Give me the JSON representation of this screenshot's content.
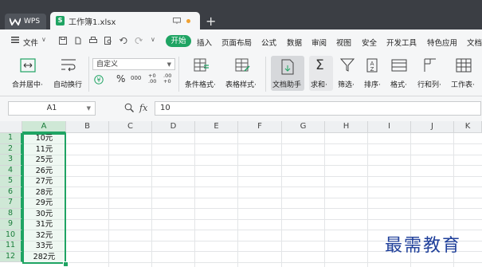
{
  "titlebar": {
    "wps_label": "WPS",
    "doc_tab": "工作簿1.xlsx",
    "add_tab": "+"
  },
  "menu": {
    "file": "文件",
    "start": "开始",
    "tabs": [
      "插入",
      "页面布局",
      "公式",
      "数据",
      "审阅",
      "视图",
      "安全",
      "开发工具",
      "特色应用",
      "文档"
    ]
  },
  "ribbon": {
    "merge": "合并居中·",
    "wrap": "自动换行",
    "number_format": "自定义",
    "percent": "%",
    "thousands": "000",
    "inc_decimal": "+0\n.00",
    "dec_decimal": ".00\n+0",
    "cond_format": "条件格式·",
    "table_style": "表格样式·",
    "doc_assist": "文档助手",
    "sum": "求和·",
    "filter": "筛选·",
    "sort": "排序·",
    "format": "格式·",
    "rowcol": "行和列·",
    "sheet": "工作表·"
  },
  "formula_bar": {
    "name_box": "A1",
    "fx": "fx",
    "value": "10"
  },
  "grid": {
    "columns": [
      "A",
      "B",
      "C",
      "D",
      "E",
      "F",
      "G",
      "H",
      "I",
      "J",
      "K"
    ],
    "rows": [
      "1",
      "2",
      "3",
      "4",
      "5",
      "6",
      "7",
      "8",
      "9",
      "10",
      "11",
      "12"
    ],
    "column_a": [
      "10元",
      "11元",
      "25元",
      "26元",
      "27元",
      "28元",
      "29元",
      "30元",
      "31元",
      "32元",
      "33元",
      "282元"
    ]
  },
  "watermark": "最需教育",
  "colors": {
    "accent": "#1fa463",
    "titlebar": "#3b3e44",
    "watermark": "#1f3f9a"
  }
}
